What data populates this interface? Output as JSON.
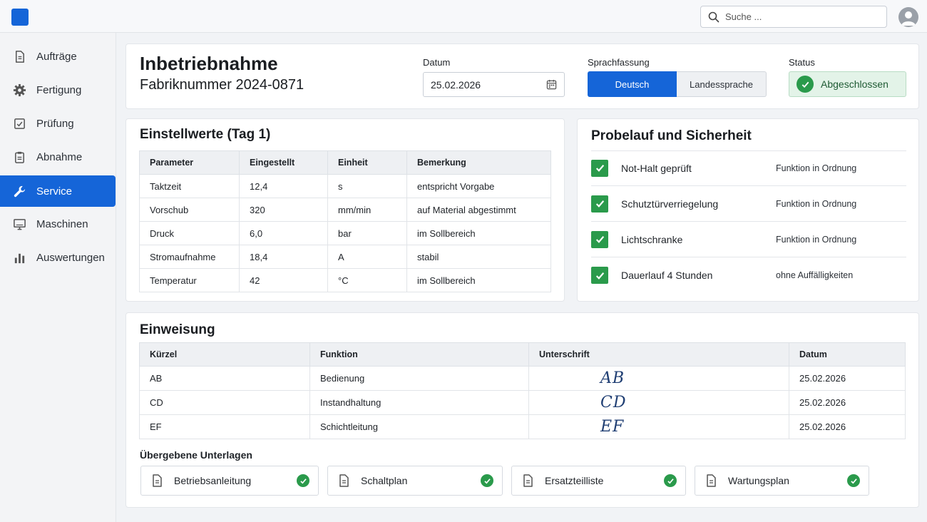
{
  "header": {
    "search_placeholder": "Suche ..."
  },
  "sidebar": {
    "items": [
      {
        "label": "Aufträge",
        "icon": "document-icon"
      },
      {
        "label": "Fertigung",
        "icon": "gear-icon"
      },
      {
        "label": "Prüfung",
        "icon": "checkbox-icon"
      },
      {
        "label": "Abnahme",
        "icon": "clipboard-icon"
      },
      {
        "label": "Service",
        "icon": "wrench-icon",
        "active": true
      },
      {
        "label": "Maschinen",
        "icon": "monitor-icon"
      },
      {
        "label": "Auswertungen",
        "icon": "bar-chart-icon"
      }
    ]
  },
  "overview": {
    "title": "Inbetriebnahme",
    "subtitle": "Fabriknummer 2024-0871",
    "date_label": "Datum",
    "date_value": "25.02.2026",
    "language_label": "Sprachfassung",
    "language_options": [
      "Deutsch",
      "Landessprache"
    ],
    "language_selected": "Deutsch",
    "status_label": "Status",
    "status_value": "Abgeschlossen"
  },
  "settings": {
    "title": "Einstellwerte (Tag 1)",
    "columns": [
      "Parameter",
      "Eingestellt",
      "Einheit",
      "Bemerkung"
    ],
    "rows": [
      [
        "Taktzeit",
        "12,4",
        "s",
        "entspricht Vorgabe"
      ],
      [
        "Vorschub",
        "320",
        "mm/min",
        "auf Material abgestimmt"
      ],
      [
        "Druck",
        "6,0",
        "bar",
        "im Sollbereich"
      ],
      [
        "Stromaufnahme",
        "18,4",
        "A",
        "stabil"
      ],
      [
        "Temperatur",
        "42",
        "°C",
        "im Sollbereich"
      ]
    ]
  },
  "trial": {
    "title": "Probelauf und Sicherheit",
    "items": [
      {
        "label": "Not-Halt geprüft",
        "result": "Funktion in Ordnung"
      },
      {
        "label": "Schutztürverriegelung",
        "result": "Funktion in Ordnung"
      },
      {
        "label": "Lichtschranke",
        "result": "Funktion in Ordnung"
      },
      {
        "label": "Dauerlauf 4 Stunden",
        "result": "ohne Auffälligkeiten"
      }
    ]
  },
  "instruction": {
    "title": "Einweisung",
    "columns": [
      "Kürzel",
      "Funktion",
      "Unterschrift",
      "Datum"
    ],
    "rows": [
      {
        "code": "AB",
        "function": "Bedienung",
        "signature": "AB",
        "date": "25.02.2026"
      },
      {
        "code": "CD",
        "function": "Instandhaltung",
        "signature": "CD",
        "date": "25.02.2026"
      },
      {
        "code": "EF",
        "function": "Schichtleitung",
        "signature": "EF",
        "date": "25.02.2026"
      }
    ],
    "documents_title": "Übergebene Unterlagen",
    "documents": [
      "Betriebsanleitung",
      "Schaltplan",
      "Ersatzteilliste",
      "Wartungsplan"
    ]
  },
  "colors": {
    "accent": "#1565d8",
    "success": "#2a9a4b"
  }
}
